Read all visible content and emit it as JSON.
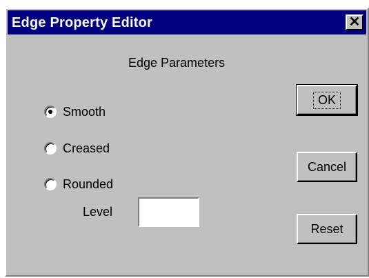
{
  "window": {
    "title": "Edge Property Editor",
    "close_glyph": "✕"
  },
  "group": {
    "heading": "Edge Parameters"
  },
  "radios": [
    {
      "label": "Smooth",
      "checked": true
    },
    {
      "label": "Creased",
      "checked": false
    },
    {
      "label": "Rounded",
      "checked": false
    }
  ],
  "level": {
    "label": "Level",
    "value": ""
  },
  "buttons": {
    "ok": "OK",
    "cancel": "Cancel",
    "reset": "Reset"
  },
  "colors": {
    "titlebar": "#000080",
    "face": "#c0c0c0"
  }
}
